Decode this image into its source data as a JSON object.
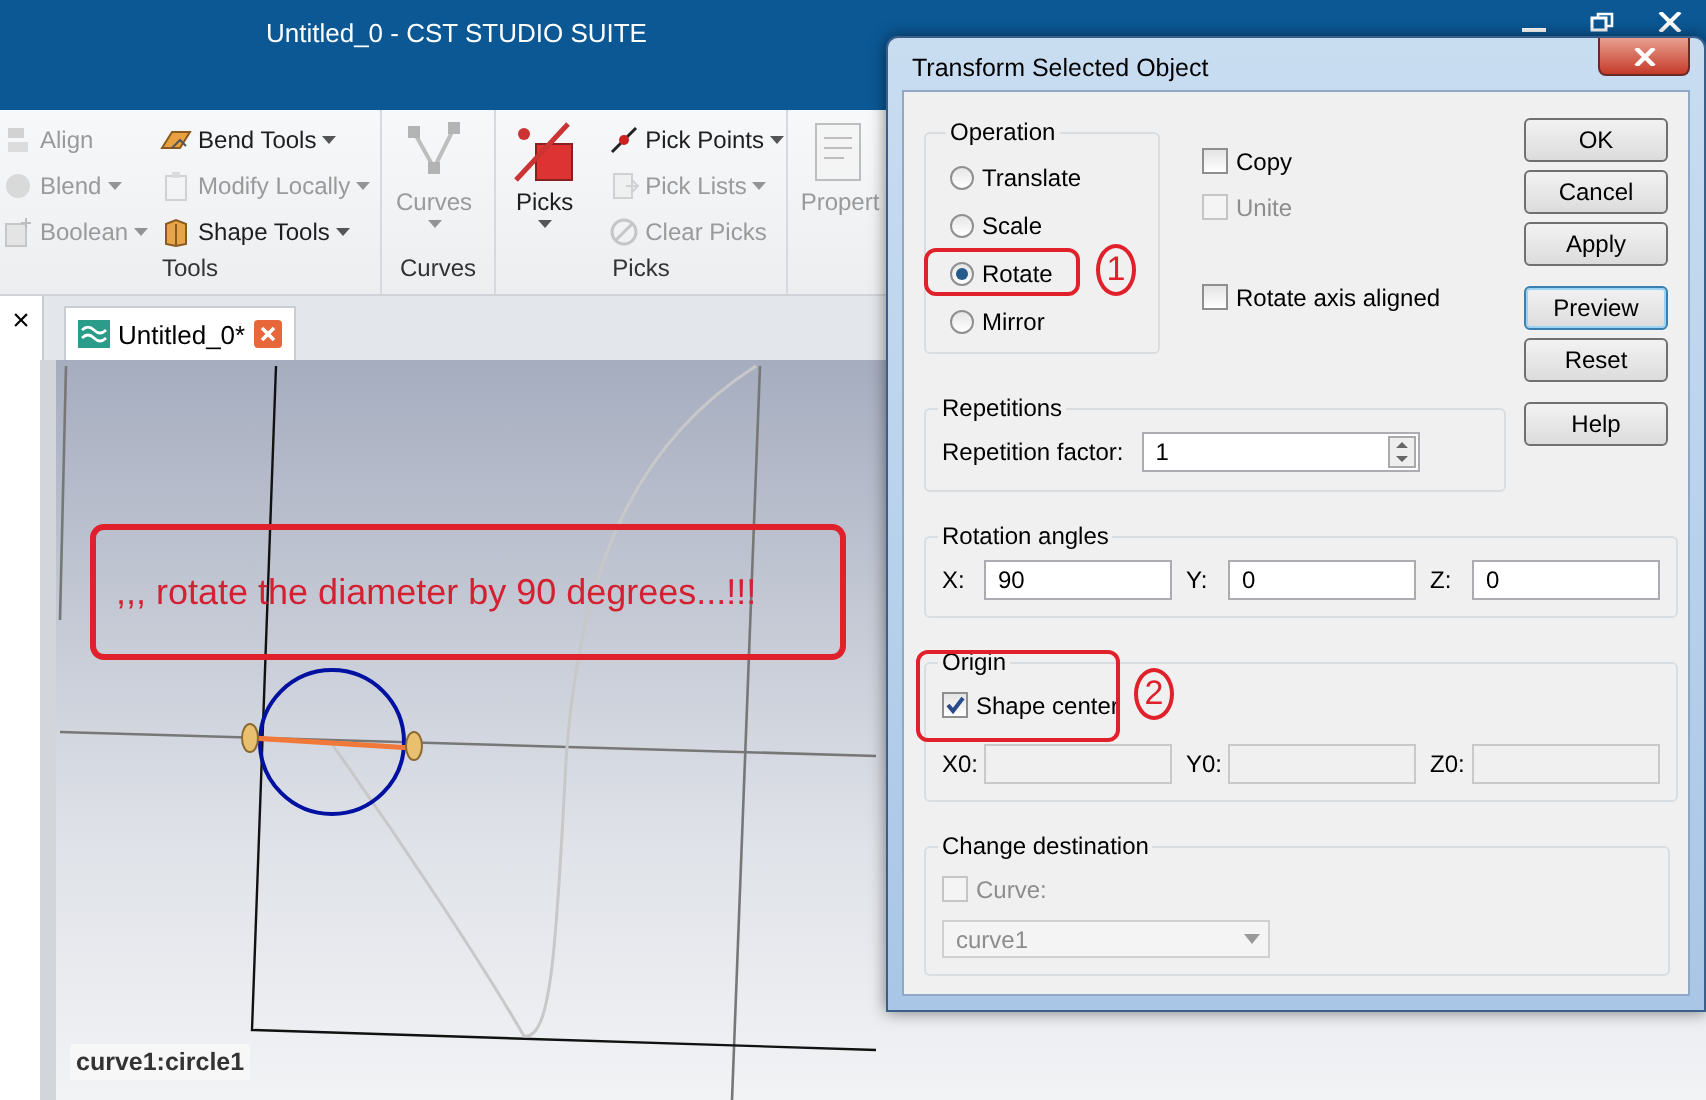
{
  "window": {
    "title": "Untitled_0 - CST STUDIO SUITE"
  },
  "ribbon": {
    "groups": [
      {
        "label": "Tools",
        "items": [
          {
            "kind": "small",
            "label": "Align",
            "disabled": true,
            "dropdown": false
          },
          {
            "kind": "small",
            "label": "Blend",
            "disabled": true,
            "dropdown": true
          },
          {
            "kind": "small",
            "label": "Boolean",
            "disabled": true,
            "dropdown": true
          },
          {
            "kind": "small",
            "label": "Bend Tools",
            "disabled": false,
            "dropdown": true
          },
          {
            "kind": "small",
            "label": "Modify Locally",
            "disabled": true,
            "dropdown": true
          },
          {
            "kind": "small",
            "label": "Shape Tools",
            "disabled": false,
            "dropdown": true
          }
        ]
      },
      {
        "label": "Curves",
        "items": [
          {
            "kind": "large",
            "label": "Curves",
            "disabled": true,
            "dropdown": true
          }
        ]
      },
      {
        "label": "Picks",
        "items": [
          {
            "kind": "large",
            "label": "Picks",
            "disabled": false,
            "dropdown": true
          },
          {
            "kind": "small",
            "label": "Pick Points",
            "disabled": false,
            "dropdown": true
          },
          {
            "kind": "small",
            "label": "Pick Lists",
            "disabled": true,
            "dropdown": true
          },
          {
            "kind": "small",
            "label": "Clear Picks",
            "disabled": true,
            "dropdown": false
          }
        ]
      },
      {
        "items": [
          {
            "kind": "large",
            "label": "Propert",
            "disabled": true,
            "dropdown": false
          }
        ]
      }
    ]
  },
  "side_panel": {
    "close": "×"
  },
  "document_tabs": [
    {
      "label": "Untitled_0*",
      "selected": true
    }
  ],
  "viewport": {
    "note": ",,, rotate the diameter by 90 degrees...!!!",
    "status": "curve1:circle1"
  },
  "dialog": {
    "title": "Transform Selected Object",
    "operation": {
      "label": "Operation",
      "options": [
        {
          "label": "Translate",
          "selected": false
        },
        {
          "label": "Scale",
          "selected": false
        },
        {
          "label": "Rotate",
          "selected": true,
          "marker": "1"
        },
        {
          "label": "Mirror",
          "selected": false
        }
      ]
    },
    "options": [
      {
        "label": "Copy",
        "checked": false,
        "disabled": false
      },
      {
        "label": "Unite",
        "checked": false,
        "disabled": true
      },
      {
        "label": "Rotate axis aligned",
        "checked": false,
        "disabled": false
      }
    ],
    "buttons": [
      {
        "label": "OK",
        "default": false
      },
      {
        "label": "Cancel",
        "default": false
      },
      {
        "label": "Apply",
        "default": false
      },
      {
        "label": "Preview",
        "default": true
      },
      {
        "label": "Reset",
        "default": false
      },
      {
        "label": "Help",
        "default": false
      }
    ],
    "repetitions": {
      "label": "Repetitions",
      "field_label": "Repetition factor:",
      "value": "1"
    },
    "rotation_angles": {
      "label": "Rotation angles",
      "fields": [
        {
          "label": "X:",
          "value": "90"
        },
        {
          "label": "Y:",
          "value": "0"
        },
        {
          "label": "Z:",
          "value": "0"
        }
      ]
    },
    "origin": {
      "label": "Origin",
      "marker": "2",
      "shape_center": {
        "label": "Shape center",
        "checked": true
      },
      "fields": [
        {
          "label": "X0:",
          "disabled": true
        },
        {
          "label": "Y0:",
          "disabled": true
        },
        {
          "label": "Z0:",
          "disabled": true
        }
      ]
    },
    "change_destination": {
      "label": "Change destination",
      "curve": {
        "label": "Curve:",
        "checked": false,
        "disabled": true
      },
      "dropdown": {
        "value": "curve1",
        "disabled": true
      }
    }
  }
}
